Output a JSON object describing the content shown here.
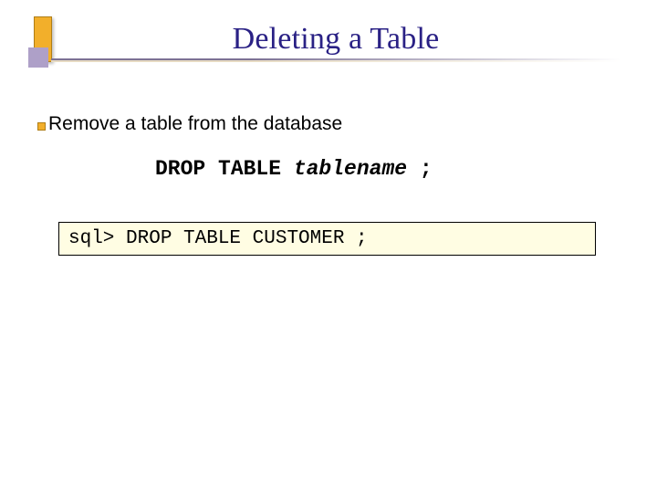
{
  "title": "Deleting a Table",
  "intro": "Remove a table from the database",
  "syntax": {
    "keyword": "DROP TABLE ",
    "param": "tablename",
    "terminator": " ;"
  },
  "code_example": "sql> DROP TABLE CUSTOMER ;"
}
